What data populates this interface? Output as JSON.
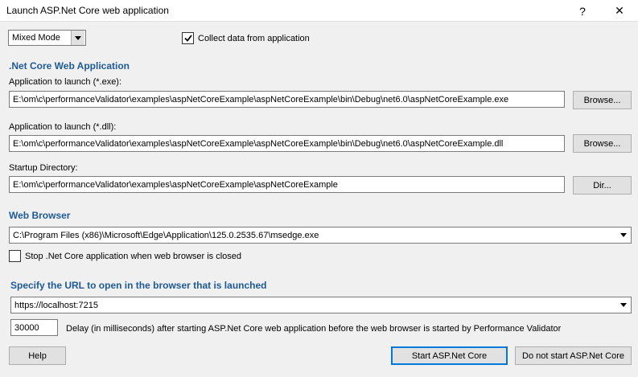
{
  "window": {
    "title": "Launch ASP.Net Core web application",
    "help_glyph": "?",
    "close_glyph": "✕"
  },
  "mode_select": {
    "value": "Mixed Mode"
  },
  "collect": {
    "label": "Collect data from application",
    "checked": true
  },
  "net_core_section": {
    "heading": ".Net Core Web Application",
    "exe_label": "Application to launch (*.exe):",
    "exe_value": "E:\\om\\c\\performanceValidator\\examples\\aspNetCoreExample\\aspNetCoreExample\\bin\\Debug\\net6.0\\aspNetCoreExample.exe",
    "exe_browse": "Browse...",
    "dll_label": "Application to launch (*.dll):",
    "dll_value": "E:\\om\\c\\performanceValidator\\examples\\aspNetCoreExample\\aspNetCoreExample\\bin\\Debug\\net6.0\\aspNetCoreExample.dll",
    "dll_browse": "Browse...",
    "dir_label": "Startup Directory:",
    "dir_value": "E:\\om\\c\\performanceValidator\\examples\\aspNetCoreExample\\aspNetCoreExample",
    "dir_button": "Dir..."
  },
  "web_browser_section": {
    "heading": "Web Browser",
    "browser_value": "C:\\Program Files (x86)\\Microsoft\\Edge\\Application\\125.0.2535.67\\msedge.exe",
    "stop_label": "Stop .Net Core application when web browser is closed",
    "stop_checked": false
  },
  "url_section": {
    "heading": "Specify the URL to open in the browser that is launched",
    "url_value": "https://localhost:7215",
    "delay_value": "30000",
    "delay_label": "Delay (in milliseconds) after starting ASP.Net Core web application before the web browser is started by Performance Validator"
  },
  "buttons": {
    "help": "Help",
    "start": "Start ASP.Net Core",
    "do_not_start": "Do not start ASP.Net Core"
  }
}
